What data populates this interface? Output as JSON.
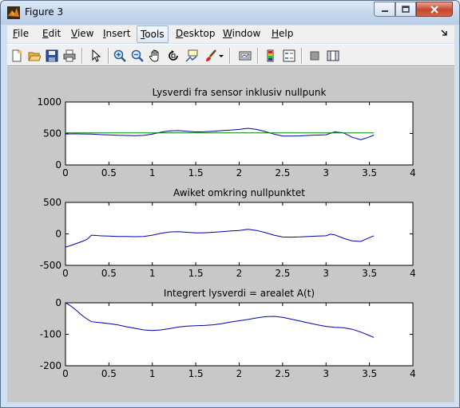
{
  "window": {
    "title": "Figure 3"
  },
  "menu": {
    "file": {
      "u": "F",
      "rest": "ile"
    },
    "edit": {
      "u": "E",
      "rest": "dit"
    },
    "view": {
      "u": "V",
      "rest": "iew"
    },
    "insert": {
      "u": "I",
      "rest": "nsert"
    },
    "tools": {
      "u": "T",
      "rest": "ools"
    },
    "desktop": {
      "u": "D",
      "rest": "esktop"
    },
    "window": {
      "u": "W",
      "rest": "indow"
    },
    "help": {
      "u": "H",
      "rest": "elp"
    }
  },
  "toolbar_icons": [
    "new-figure-icon",
    "open-file-icon",
    "save-icon",
    "print-icon",
    "edit-plot-arrow-icon",
    "zoom-in-icon",
    "zoom-out-icon",
    "pan-hand-icon",
    "rotate-3d-icon",
    "data-cursor-icon",
    "brush-icon",
    "brush-dropdown-icon",
    "link-plot-icon",
    "colorbar-icon",
    "legend-icon",
    "hide-plot-tools-icon",
    "show-plot-tools-icon"
  ],
  "chart_data": [
    {
      "type": "line",
      "title": "Lysverdi fra sensor inklusiv nullpunk",
      "xlim": [
        0,
        4
      ],
      "ylim": [
        0,
        1000
      ],
      "xticks": [
        "0",
        "0.5",
        "1",
        "1.5",
        "2",
        "2.5",
        "3",
        "3.5",
        "4"
      ],
      "yticks": [
        "0",
        "500",
        "1000"
      ],
      "series": [
        {
          "color": "#0000aa",
          "x": [
            0,
            0.1,
            0.2,
            0.3,
            0.4,
            0.5,
            0.6,
            0.7,
            0.8,
            0.9,
            1.0,
            1.1,
            1.2,
            1.3,
            1.4,
            1.5,
            1.6,
            1.7,
            1.8,
            1.9,
            2.0,
            2.1,
            2.2,
            2.3,
            2.4,
            2.5,
            2.6,
            2.7,
            2.8,
            2.9,
            3.0,
            3.1,
            3.2,
            3.3,
            3.4,
            3.5,
            3.55
          ],
          "y": [
            490,
            495,
            492,
            490,
            482,
            478,
            472,
            468,
            466,
            470,
            490,
            520,
            540,
            545,
            535,
            525,
            528,
            535,
            545,
            555,
            565,
            582,
            565,
            530,
            490,
            460,
            458,
            462,
            470,
            475,
            480,
            525,
            510,
            440,
            400,
            445,
            475
          ]
        },
        {
          "color": "#008000",
          "x": [
            0,
            3.55
          ],
          "y": [
            510,
            510
          ]
        }
      ]
    },
    {
      "type": "line",
      "title": "Awiket omkring nullpunktet",
      "xlim": [
        0,
        4
      ],
      "ylim": [
        -500,
        500
      ],
      "xticks": [
        "0",
        "0.5",
        "1",
        "1.5",
        "2",
        "2.5",
        "3",
        "3.5",
        "4"
      ],
      "yticks": [
        "-500",
        "0",
        "500"
      ],
      "series": [
        {
          "color": "#0000aa",
          "x": [
            0,
            0.05,
            0.1,
            0.15,
            0.2,
            0.25,
            0.3,
            0.35,
            0.4,
            0.5,
            0.6,
            0.7,
            0.8,
            0.9,
            1.0,
            1.1,
            1.2,
            1.3,
            1.4,
            1.5,
            1.6,
            1.7,
            1.8,
            1.9,
            2.0,
            2.1,
            2.2,
            2.3,
            2.4,
            2.5,
            2.6,
            2.7,
            2.8,
            2.9,
            3.0,
            3.05,
            3.1,
            3.2,
            3.3,
            3.4,
            3.5,
            3.55
          ],
          "y": [
            -210,
            -190,
            -165,
            -140,
            -115,
            -85,
            -20,
            -25,
            -30,
            -35,
            -40,
            -42,
            -44,
            -40,
            -20,
            10,
            30,
            35,
            25,
            15,
            18,
            25,
            35,
            45,
            55,
            72,
            55,
            20,
            -20,
            -50,
            -52,
            -48,
            -40,
            -35,
            -30,
            -5,
            -15,
            -70,
            -110,
            -120,
            -60,
            -30
          ]
        }
      ]
    },
    {
      "type": "line",
      "title": "Integrert lysverdi = arealet A(t)",
      "xlim": [
        0,
        4
      ],
      "ylim": [
        -200,
        0
      ],
      "xticks": [
        "0",
        "0.5",
        "1",
        "1.5",
        "2",
        "2.5",
        "3",
        "3.5",
        "4"
      ],
      "yticks": [
        "-200",
        "-100",
        "0"
      ],
      "series": [
        {
          "color": "#0000aa",
          "x": [
            0,
            0.05,
            0.1,
            0.15,
            0.2,
            0.25,
            0.3,
            0.4,
            0.5,
            0.6,
            0.7,
            0.8,
            0.9,
            1.0,
            1.1,
            1.2,
            1.3,
            1.4,
            1.5,
            1.6,
            1.7,
            1.8,
            1.9,
            2.0,
            2.1,
            2.2,
            2.3,
            2.4,
            2.5,
            2.6,
            2.7,
            2.8,
            2.9,
            3.0,
            3.1,
            3.2,
            3.3,
            3.4,
            3.5,
            3.55
          ],
          "y": [
            0,
            -8,
            -18,
            -30,
            -42,
            -52,
            -60,
            -63,
            -66,
            -70,
            -76,
            -81,
            -86,
            -88,
            -86,
            -82,
            -77,
            -74,
            -73,
            -72,
            -70,
            -66,
            -61,
            -57,
            -53,
            -48,
            -44,
            -43,
            -46,
            -52,
            -58,
            -64,
            -70,
            -75,
            -78,
            -79,
            -84,
            -93,
            -104,
            -110
          ]
        }
      ]
    }
  ]
}
